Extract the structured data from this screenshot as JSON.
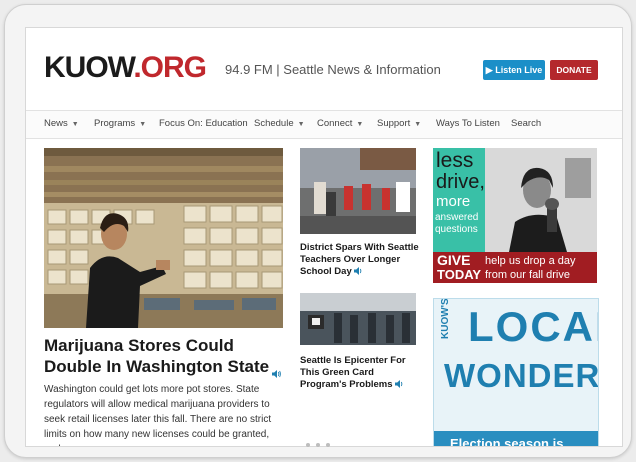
{
  "header": {
    "logo_main": "KUOW",
    "logo_org": ".ORG",
    "tagline": "94.9 FM | Seattle News & Information",
    "listen_live": "Listen Live",
    "donate": "DONATE"
  },
  "nav": {
    "items": [
      {
        "label": "News",
        "dropdown": true
      },
      {
        "label": "Programs",
        "dropdown": true
      },
      {
        "label": "Focus On: Education",
        "dropdown": false
      },
      {
        "label": "Schedule",
        "dropdown": true
      },
      {
        "label": "Connect",
        "dropdown": true
      },
      {
        "label": "Support",
        "dropdown": true
      },
      {
        "label": "Ways To Listen",
        "dropdown": false
      },
      {
        "label": "Search",
        "dropdown": false
      }
    ]
  },
  "main_story": {
    "title": "Marijuana Stores Could Double In Washington State",
    "description": "Washington could get lots more pot stores. State regulators will allow medical marijuana providers to seek retail licenses later this fall. There are no strict limits on how many new licenses could be granted, and"
  },
  "side_stories": [
    {
      "title": "District Spars With Seattle Teachers Over Longer School Day"
    },
    {
      "title": "Seattle Is Epicenter For This Green Card Program's Problems"
    }
  ],
  "ad_pledge": {
    "less": "less",
    "drive": "drive,",
    "more": "more",
    "answered": "answered",
    "questions": "questions",
    "give": "GIVE",
    "today": "TODAY",
    "line1": "help us drop a day",
    "line2": "from our fall drive"
  },
  "ad_local_wonder": {
    "kuows": "KUOW'S",
    "local": "LOCAL",
    "wonder": "WONDER",
    "footer": "Election season is"
  },
  "colors": {
    "brand_red": "#c0282d",
    "listen_blue": "#1b8fc8",
    "donate_red": "#b4282c",
    "audio_blue": "#1f7fb0"
  }
}
